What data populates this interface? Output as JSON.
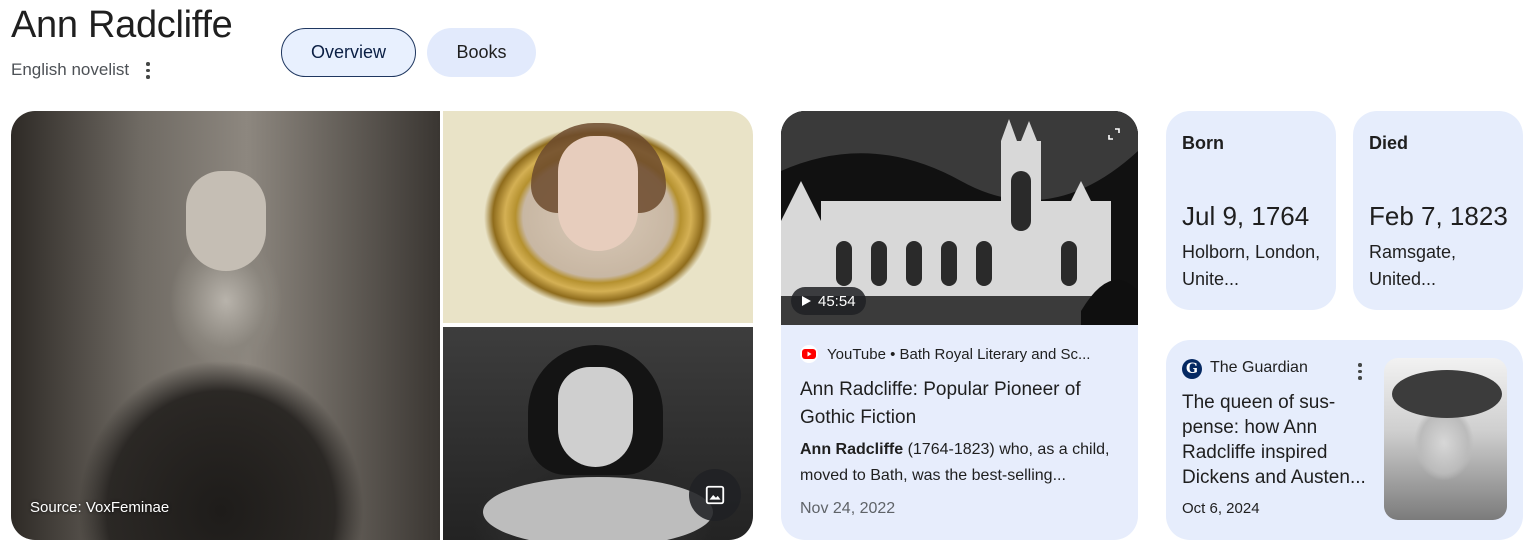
{
  "header": {
    "title": "Ann Radcliffe",
    "subtitle": "English novelist"
  },
  "tabs": [
    {
      "label": "Overview",
      "selected": true
    },
    {
      "label": "Books",
      "selected": false
    }
  ],
  "gallery": {
    "source_caption": "Source: VoxFeminae"
  },
  "video": {
    "duration": "45:54",
    "source": "YouTube • Bath Royal Literary and Sc...",
    "title": "Ann Radcliffe: Popular Pioneer of Gothic Fiction",
    "snippet_bold": "Ann Radcliffe",
    "snippet_rest": " (1764-1823) who, as a child, moved to Bath, was the best-selling...",
    "date": "Nov 24, 2022"
  },
  "facts": {
    "born": {
      "label": "Born",
      "date": "Jul 9, 1764",
      "place": "Holborn, London, Unite..."
    },
    "died": {
      "label": "Died",
      "date": "Feb 7, 1823",
      "place": "Ramsgate, United..."
    }
  },
  "news": {
    "source": "The Guardian",
    "title": "The queen of sus-pense: how Ann Radcliffe inspired Dickens and Austen...",
    "date": "Oct 6, 2024"
  },
  "colors": {
    "card_bg": "#e6edfc",
    "chip_selected_border": "#1f3760",
    "youtube_red": "#ff0000",
    "guardian_blue": "#052962"
  }
}
